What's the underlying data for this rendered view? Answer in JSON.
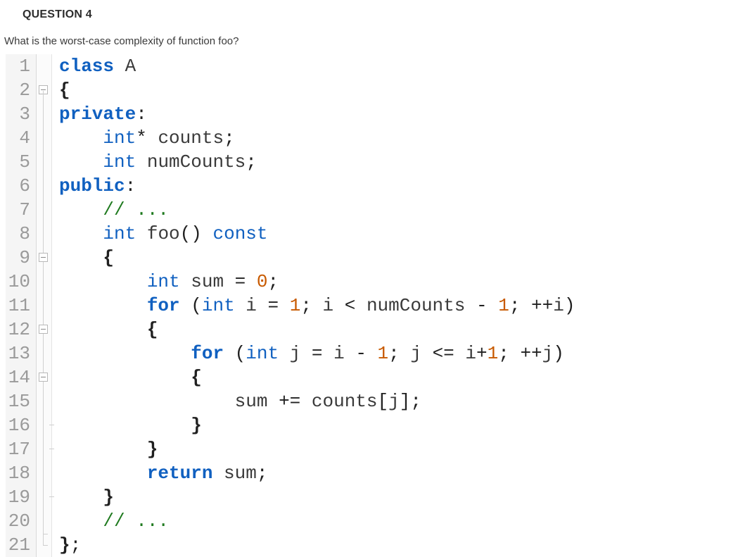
{
  "question": {
    "title": "QUESTION 4",
    "prompt": "What is the worst-case complexity of function foo?"
  },
  "code": {
    "lines": [
      {
        "n": "1",
        "fold": "",
        "html": "<span class='kw'>class</span> A"
      },
      {
        "n": "2",
        "fold": "box-start",
        "html": "<span class='brace'>{</span>"
      },
      {
        "n": "3",
        "fold": "line",
        "html": "<span class='kw'>private</span><span class='punct'>:</span>"
      },
      {
        "n": "4",
        "fold": "line",
        "html": "    <span class='kw2'>int</span><span class='op'>*</span> counts<span class='punct'>;</span>"
      },
      {
        "n": "5",
        "fold": "line",
        "html": "    <span class='kw2'>int</span> numCounts<span class='punct'>;</span>"
      },
      {
        "n": "6",
        "fold": "line",
        "html": "<span class='kw'>public</span><span class='punct'>:</span>"
      },
      {
        "n": "7",
        "fold": "line",
        "html": "    <span class='cmt'>// ...</span>"
      },
      {
        "n": "8",
        "fold": "line",
        "html": "    <span class='kw2'>int</span> foo<span class='punct'>()</span> <span class='kw2'>const</span>"
      },
      {
        "n": "9",
        "fold": "box",
        "html": "    <span class='brace'>{</span>"
      },
      {
        "n": "10",
        "fold": "line",
        "html": "        <span class='kw2'>int</span> sum <span class='op'>=</span> <span class='num'>0</span><span class='punct'>;</span>"
      },
      {
        "n": "11",
        "fold": "line",
        "html": "        <span class='kw'>for</span> <span class='punct'>(</span><span class='kw2'>int</span> i <span class='op'>=</span> <span class='num'>1</span><span class='punct'>;</span> i <span class='op'>&lt;</span> numCounts <span class='op'>-</span> <span class='num'>1</span><span class='punct'>;</span> <span class='op'>++</span>i<span class='punct'>)</span>"
      },
      {
        "n": "12",
        "fold": "box",
        "html": "        <span class='brace'>{</span>"
      },
      {
        "n": "13",
        "fold": "line",
        "html": "            <span class='kw'>for</span> <span class='punct'>(</span><span class='kw2'>int</span> j <span class='op'>=</span> i <span class='op'>-</span> <span class='num'>1</span><span class='punct'>;</span> j <span class='op'>&lt;=</span> i<span class='op'>+</span><span class='num'>1</span><span class='punct'>;</span> <span class='op'>++</span>j<span class='punct'>)</span>"
      },
      {
        "n": "14",
        "fold": "box",
        "html": "            <span class='brace'>{</span>"
      },
      {
        "n": "15",
        "fold": "line",
        "html": "                sum <span class='op'>+=</span> counts<span class='punct'>[</span>j<span class='punct'>];</span>"
      },
      {
        "n": "16",
        "fold": "tick",
        "html": "            <span class='brace'>}</span>"
      },
      {
        "n": "17",
        "fold": "tick",
        "html": "        <span class='brace'>}</span>"
      },
      {
        "n": "18",
        "fold": "line",
        "html": "        <span class='kw'>return</span> sum<span class='punct'>;</span>"
      },
      {
        "n": "19",
        "fold": "tick",
        "html": "    <span class='brace'>}</span>"
      },
      {
        "n": "20",
        "fold": "line",
        "html": "    <span class='cmt'>// ...</span>"
      },
      {
        "n": "21",
        "fold": "end",
        "html": "<span class='brace'>}</span><span class='punct'>;</span>"
      }
    ]
  }
}
